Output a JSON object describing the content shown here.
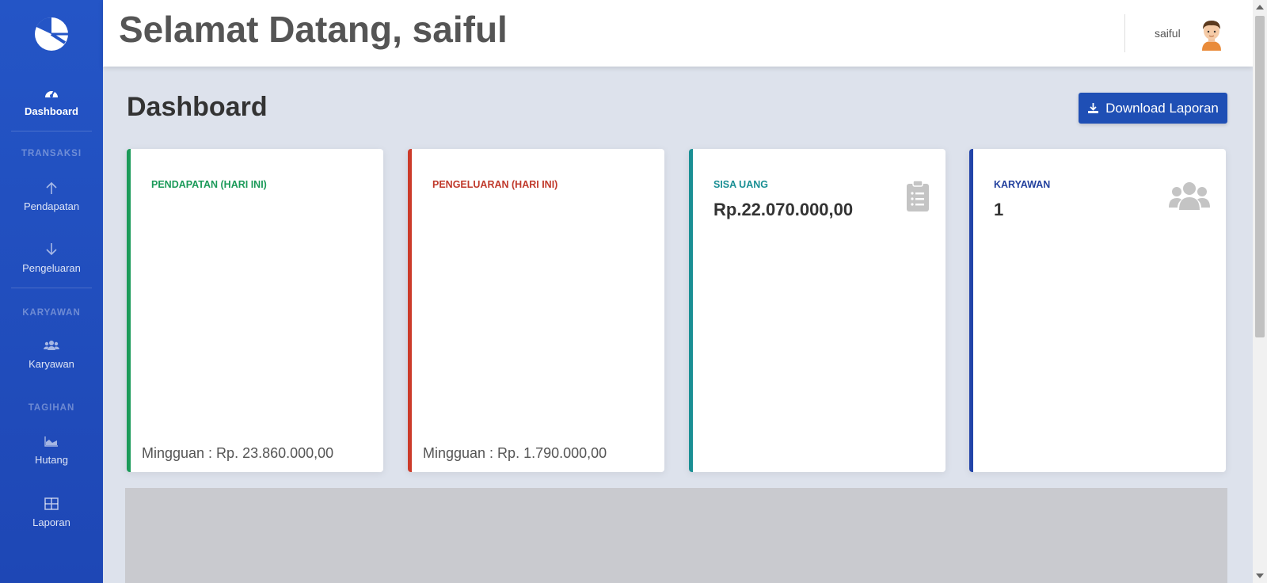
{
  "app": {
    "accent_color": "#1f4fb5",
    "sidebar_color": "#2455c6"
  },
  "sidebar": {
    "brand_icon": "pie-chart-icon",
    "items": [
      {
        "label": "Dashboard",
        "icon": "tachometer-icon",
        "active": true
      },
      {
        "label": "Pendapatan",
        "icon": "arrow-up-icon"
      },
      {
        "label": "Pengeluaran",
        "icon": "arrow-down-icon"
      },
      {
        "label": "Karyawan",
        "icon": "users-icon"
      },
      {
        "label": "Hutang",
        "icon": "area-chart-icon"
      },
      {
        "label": "Laporan",
        "icon": "table-icon"
      }
    ],
    "sections": [
      "TRANSAKSI",
      "KARYAWAN",
      "TAGIHAN"
    ]
  },
  "topbar": {
    "welcome": "Selamat Datang, saiful",
    "username": "saiful"
  },
  "main": {
    "title": "Dashboard",
    "download_button": "Download Laporan",
    "cards": [
      {
        "header": "PENDAPATAN (HARI INI)",
        "value": "",
        "footer": "Mingguan : Rp. 23.860.000,00",
        "color": "#1b9a59"
      },
      {
        "header": "PENGELUARAN (HARI INI)",
        "value": "",
        "footer": "Mingguan : Rp. 1.790.000,00",
        "color": "#cc3b2a"
      },
      {
        "header": "SISA UANG",
        "value": "Rp.22.070.000,00",
        "icon": "clipboard-list-icon",
        "color": "#1a8f94"
      },
      {
        "header": "KARYAWAN",
        "value": "1",
        "icon": "users-icon",
        "color": "#2244a8"
      }
    ]
  }
}
